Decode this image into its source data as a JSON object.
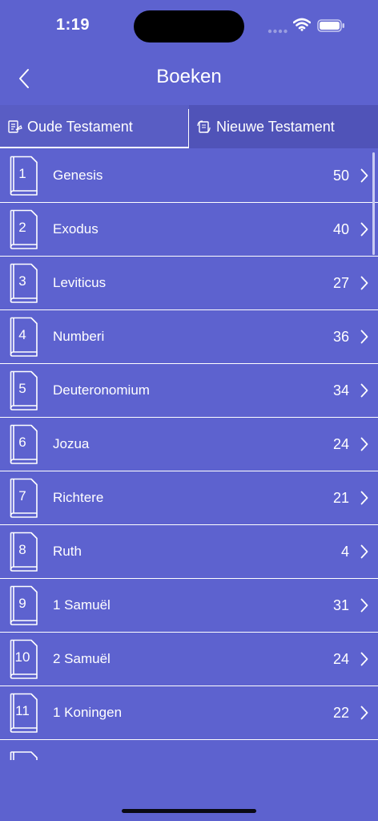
{
  "status_bar": {
    "time": "1:19"
  },
  "nav": {
    "title": "Boeken"
  },
  "tabs": [
    {
      "label": "Oude Testament",
      "icon": "old-testament-icon",
      "active": true
    },
    {
      "label": "Nieuwe Testament",
      "icon": "new-testament-icon",
      "active": false
    }
  ],
  "books": [
    {
      "number": "1",
      "name": "Genesis",
      "chapters": "50"
    },
    {
      "number": "2",
      "name": "Exodus",
      "chapters": "40"
    },
    {
      "number": "3",
      "name": "Leviticus",
      "chapters": "27"
    },
    {
      "number": "4",
      "name": "Numberi",
      "chapters": "36"
    },
    {
      "number": "5",
      "name": "Deuteronomium",
      "chapters": "34"
    },
    {
      "number": "6",
      "name": "Jozua",
      "chapters": "24"
    },
    {
      "number": "7",
      "name": "Richtere",
      "chapters": "21"
    },
    {
      "number": "8",
      "name": "Ruth",
      "chapters": "4"
    },
    {
      "number": "9",
      "name": "1 Samuël",
      "chapters": "31"
    },
    {
      "number": "10",
      "name": "2 Samuël",
      "chapters": "24"
    },
    {
      "number": "11",
      "name": "1 Koningen",
      "chapters": "22"
    }
  ],
  "colors": {
    "background": "#5d62cf",
    "tab_bar": "#5053b8",
    "foreground": "#ffffff"
  }
}
